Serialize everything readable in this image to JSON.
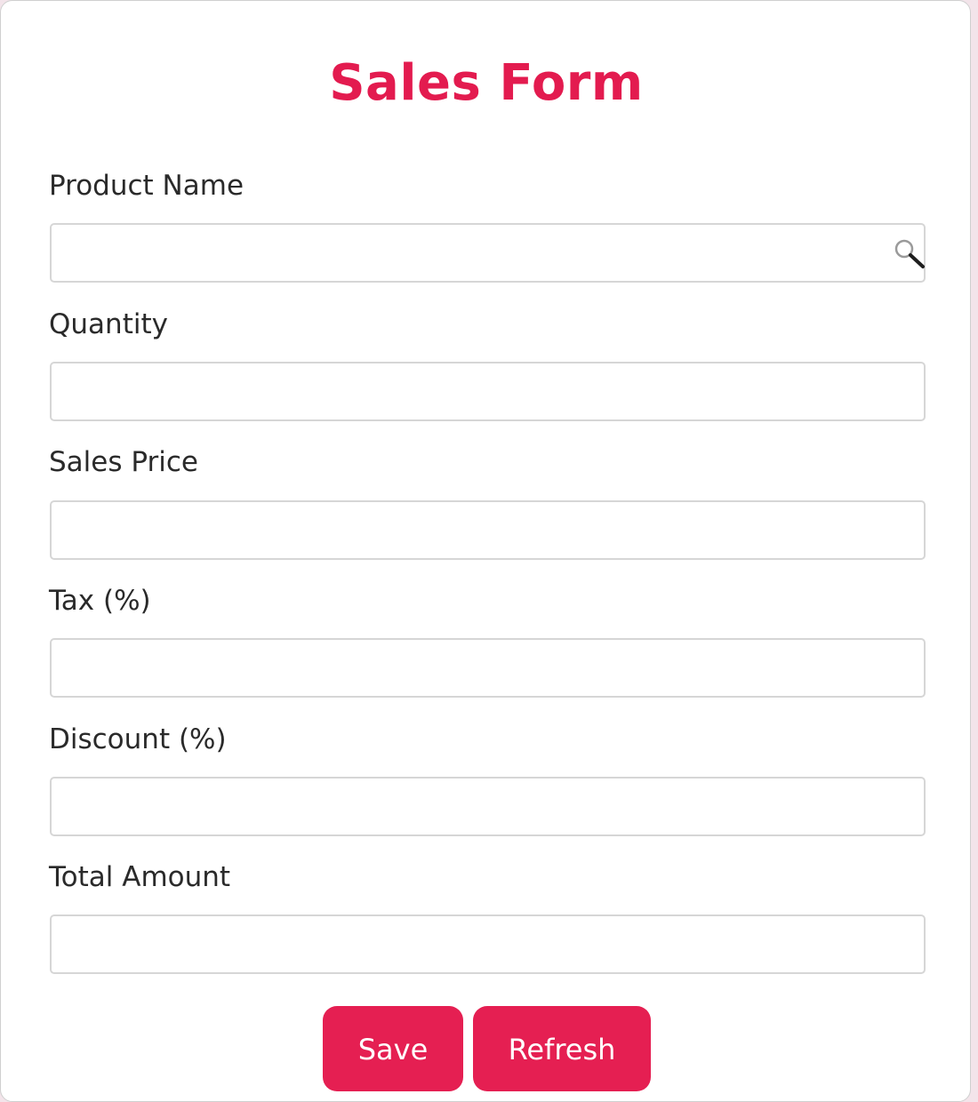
{
  "form": {
    "title": "Sales Form",
    "fields": [
      {
        "label": "Product Name",
        "value": "",
        "icon": "search-icon"
      },
      {
        "label": "Quantity",
        "value": ""
      },
      {
        "label": "Sales Price",
        "value": ""
      },
      {
        "label": "Tax (%)",
        "value": ""
      },
      {
        "label": "Discount (%)",
        "value": ""
      },
      {
        "label": "Total Amount",
        "value": ""
      }
    ],
    "buttons": {
      "save_label": "Save",
      "refresh_label": "Refresh"
    }
  },
  "colors": {
    "accent": "#e51f52",
    "title": "#e31b4f",
    "background": "#f3e4ea"
  }
}
